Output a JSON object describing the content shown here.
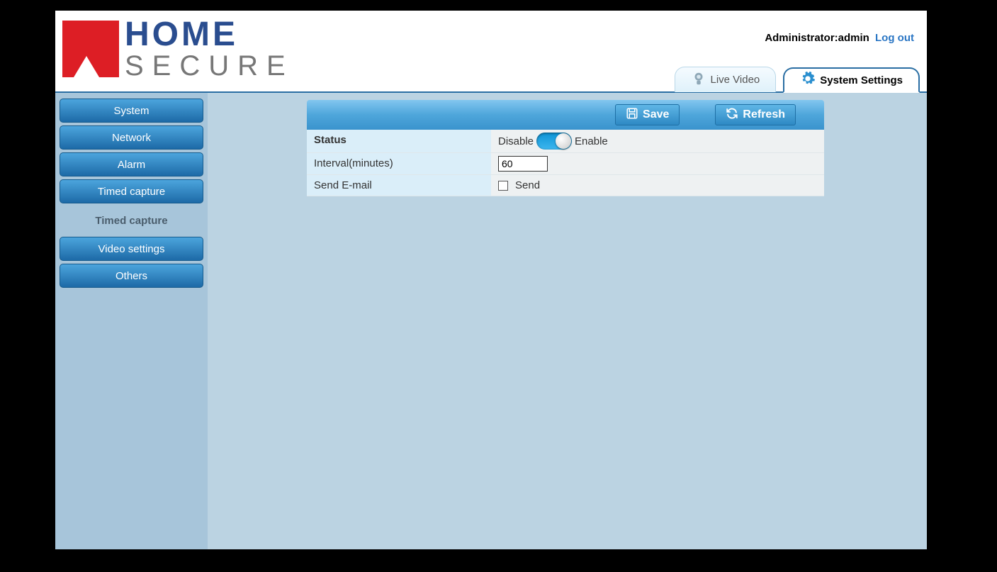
{
  "header": {
    "logo_home": "HOME",
    "logo_secure": "SECURE",
    "user_prefix": "Administrator:",
    "user_name": "admin",
    "logout": "Log out"
  },
  "tabs": {
    "live_video": "Live Video",
    "system_settings": "System Settings"
  },
  "sidebar": {
    "system": "System",
    "network": "Network",
    "alarm": "Alarm",
    "timed_capture": "Timed capture",
    "timed_capture_sub": "Timed capture",
    "video_settings": "Video settings",
    "others": "Others"
  },
  "toolbar": {
    "save": "Save",
    "refresh": "Refresh"
  },
  "form": {
    "status_label": "Status",
    "status_disable": "Disable",
    "status_enable": "Enable",
    "status_value": "enable",
    "interval_label": "Interval(minutes)",
    "interval_value": "60",
    "email_label": "Send E-mail",
    "email_checkbox_label": "Send",
    "email_checked": false
  }
}
